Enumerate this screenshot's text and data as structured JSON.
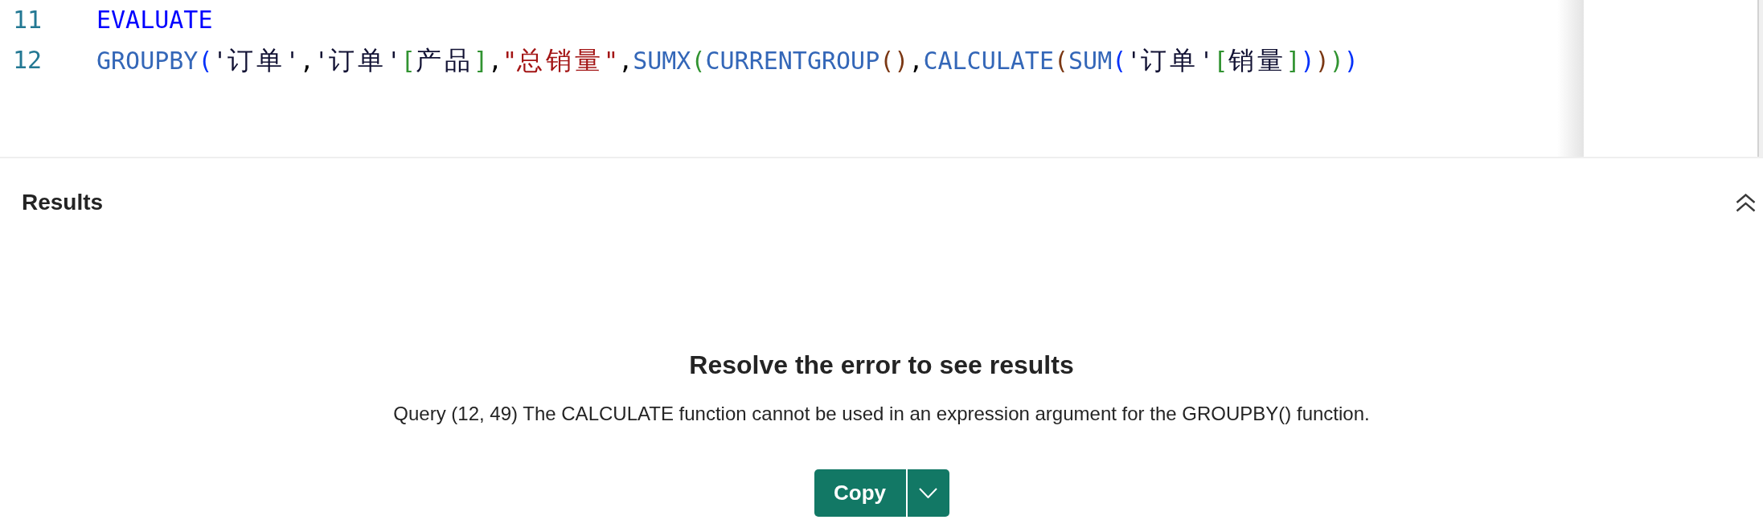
{
  "editor": {
    "lines": [
      {
        "number": "11",
        "tokens": [
          {
            "kind": "keyword",
            "text": "EVALUATE"
          }
        ]
      },
      {
        "number": "12",
        "tokens": [
          {
            "kind": "function",
            "text": "GROUPBY"
          },
          {
            "kind": "open",
            "text": "("
          },
          {
            "kind": "table",
            "text": "'订单'"
          },
          {
            "kind": "punct",
            "text": ","
          },
          {
            "kind": "table",
            "text": "'订单'"
          },
          {
            "kind": "open",
            "text": "["
          },
          {
            "kind": "column",
            "text": "产品"
          },
          {
            "kind": "close",
            "text": "]"
          },
          {
            "kind": "punct",
            "text": ","
          },
          {
            "kind": "string",
            "text": "\"总销量\""
          },
          {
            "kind": "punct",
            "text": ","
          },
          {
            "kind": "function",
            "text": "SUMX"
          },
          {
            "kind": "open",
            "text": "("
          },
          {
            "kind": "function",
            "text": "CURRENTGROUP"
          },
          {
            "kind": "open",
            "text": "("
          },
          {
            "kind": "close",
            "text": ")"
          },
          {
            "kind": "punct",
            "text": ","
          },
          {
            "kind": "function",
            "text": "CALCULATE"
          },
          {
            "kind": "open",
            "text": "("
          },
          {
            "kind": "function",
            "text": "SUM"
          },
          {
            "kind": "open",
            "text": "("
          },
          {
            "kind": "table",
            "text": "'订单'"
          },
          {
            "kind": "open",
            "text": "["
          },
          {
            "kind": "column",
            "text": "销量"
          },
          {
            "kind": "close",
            "text": "]"
          },
          {
            "kind": "close",
            "text": ")"
          },
          {
            "kind": "close",
            "text": ")"
          },
          {
            "kind": "close",
            "text": ")"
          },
          {
            "kind": "close",
            "text": ")"
          }
        ]
      }
    ]
  },
  "results": {
    "title": "Results",
    "error": {
      "heading": "Resolve the error to see results",
      "message": "Query (12, 49) The CALCULATE function cannot be used in an expression argument for the GROUPBY() function."
    },
    "copy_button": {
      "label": "Copy"
    }
  }
}
